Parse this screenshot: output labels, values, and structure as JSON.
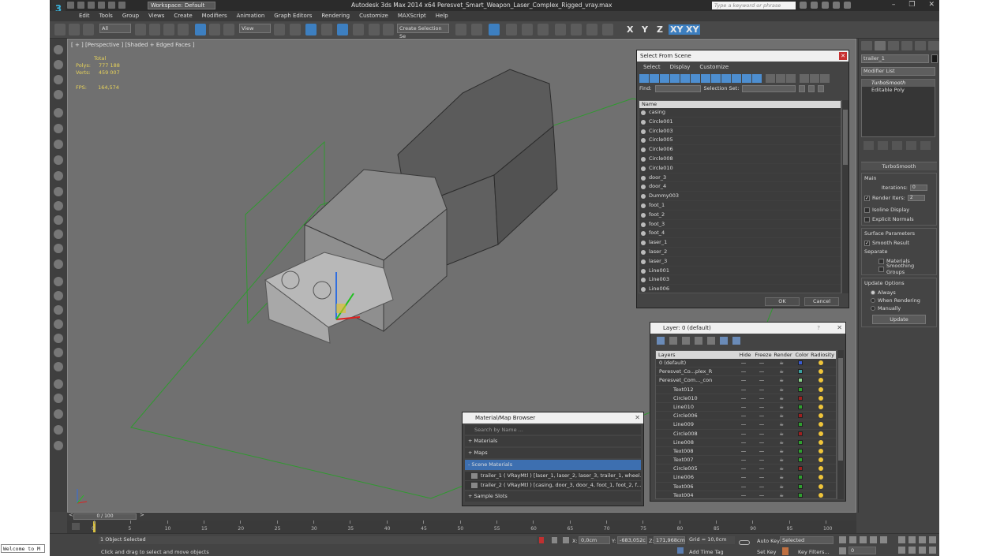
{
  "titlebar": {
    "workspace": "Workspace: Default",
    "title": "Autodesk 3ds Max  2014 x64    Peresvet_Smart_Weapon_Laser_Complex_Rigged_vray.max",
    "search_placeholder": "Type a keyword or phrase"
  },
  "menu": [
    "Edit",
    "Tools",
    "Group",
    "Views",
    "Create",
    "Modifiers",
    "Animation",
    "Graph Editors",
    "Rendering",
    "Customize",
    "MAXScript",
    "Help"
  ],
  "toolbar": {
    "filter": "All",
    "ref_coord": "View",
    "selection_set_placeholder": "Create Selection Se",
    "axes": [
      "X",
      "Y",
      "Z",
      "XY",
      "XY"
    ]
  },
  "viewport": {
    "label": "[ + ] [Perspective ] [Shaded + Edged Faces ]",
    "stats": {
      "total": "Total",
      "polys_label": "Polys:",
      "polys": "777 188",
      "verts_label": "Verts:",
      "verts": "459 007",
      "fps_label": "FPS:",
      "fps": "164,574"
    }
  },
  "command_panel": {
    "object_name": "trailer_1",
    "modifier_list": "Modifier List",
    "stack": [
      "TurboSmooth",
      "Editable Poly"
    ],
    "turbosmooth": {
      "title": "TurboSmooth",
      "main": "Main",
      "iterations_label": "Iterations:",
      "iterations": "0",
      "render_iters_label": "Render Iters:",
      "render_iters": "2",
      "isoline": "Isoline Display",
      "explicit_normals": "Explicit Normals",
      "surface_params": "Surface Parameters",
      "smooth_result": "Smooth Result",
      "separate": "Separate",
      "materials": "Materials",
      "smoothing_groups": "Smoothing Groups",
      "update_options": "Update Options",
      "always": "Always",
      "when_rendering": "When Rendering",
      "manually": "Manually",
      "update_btn": "Update"
    }
  },
  "select_from_scene": {
    "title": "Select From Scene",
    "menu": [
      "Select",
      "Display",
      "Customize"
    ],
    "find_label": "Find:",
    "selection_set_label": "Selection Set:",
    "column_name": "Name",
    "items": [
      "casing",
      "Circle001",
      "Circle003",
      "Circle005",
      "Circle006",
      "Circle008",
      "Circle010",
      "door_3",
      "door_4",
      "Dummy003",
      "foot_1",
      "foot_2",
      "foot_3",
      "foot_4",
      "laser_1",
      "laser_2",
      "laser_3",
      "Line001",
      "Line003",
      "Line006"
    ],
    "ok": "OK",
    "cancel": "Cancel"
  },
  "layer_dialog": {
    "title": "Layer: 0 (default)",
    "question": "?",
    "columns": [
      "Layers",
      "Hide",
      "Freeze",
      "Render",
      "Color",
      "Radiosity"
    ],
    "rows": [
      {
        "name": "0 (default)",
        "color": "#3a5bd0"
      },
      {
        "name": "Peresvet_Co...plex_R",
        "color": "#3aa0a0"
      },
      {
        "name": "Peresvet_Com..._con",
        "color": "#8ad08a"
      },
      {
        "name": "Text012",
        "color": "#2fa02f"
      },
      {
        "name": "Circle010",
        "color": "#a02020"
      },
      {
        "name": "Line010",
        "color": "#2fa02f"
      },
      {
        "name": "Circle006",
        "color": "#a02020"
      },
      {
        "name": "Line009",
        "color": "#2fa02f"
      },
      {
        "name": "Circle008",
        "color": "#a02020"
      },
      {
        "name": "Line008",
        "color": "#2fa02f"
      },
      {
        "name": "Text008",
        "color": "#2fa02f"
      },
      {
        "name": "Text007",
        "color": "#2fa02f"
      },
      {
        "name": "Circle005",
        "color": "#a02020"
      },
      {
        "name": "Line006",
        "color": "#2fa02f"
      },
      {
        "name": "Text006",
        "color": "#2fa02f"
      },
      {
        "name": "Text004",
        "color": "#2fa02f"
      }
    ]
  },
  "material_browser": {
    "title": "Material/Map Browser",
    "search_placeholder": "Search by Name ...",
    "groups": [
      "+ Materials",
      "+ Maps",
      "- Scene Materials"
    ],
    "items": [
      "trailer_1  ( VRayMtl )  [laser_1, laser_2, laser_3, trailer_1, wheel...",
      "trailer_2  ( VRayMtl )  [casing, door_3, door_4, foot_1, foot_2, f..."
    ],
    "sample_slots": "+ Sample Slots"
  },
  "timeline": {
    "frame": "0 / 100",
    "ticks": [
      "0",
      "5",
      "10",
      "15",
      "20",
      "25",
      "30",
      "35",
      "40",
      "45",
      "50",
      "55",
      "60",
      "65",
      "70",
      "75",
      "80",
      "85",
      "90",
      "95",
      "100"
    ]
  },
  "status": {
    "listener": "Welcome to M",
    "selected": "1 Object Selected",
    "prompt": "Click and drag to select and move objects",
    "x_label": "X:",
    "x": "0,0cm",
    "y_label": "Y:",
    "y": "-683,052c",
    "z_label": "Z:",
    "z": "171,968cm",
    "grid": "Grid = 10,0cm",
    "autokey": "Auto Key",
    "autokey_mode": "Selected",
    "setkey": "Set Key",
    "keyfilters": "Key Filters...",
    "add_time_tag": "Add Time Tag",
    "frame_field": "0"
  }
}
